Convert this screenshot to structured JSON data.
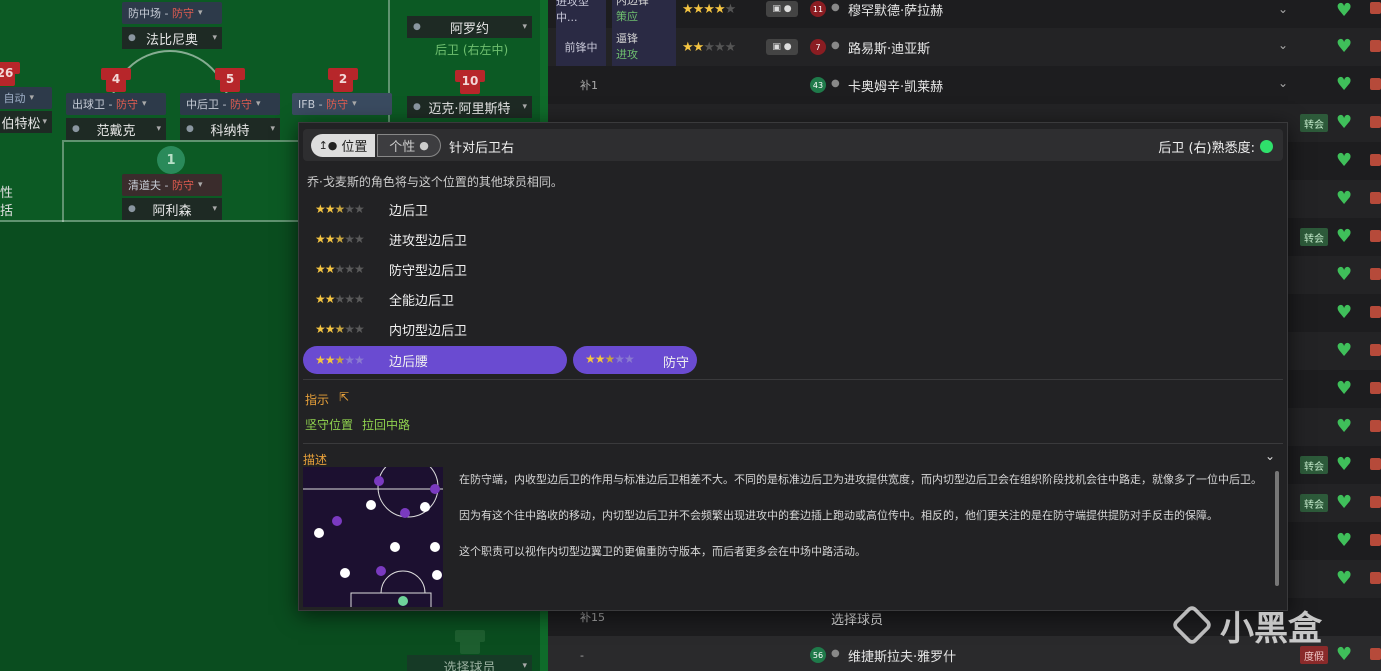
{
  "pitch": {
    "positions": [
      {
        "role": "防中场",
        "duty": "防守",
        "name": "法比尼奥"
      },
      {
        "role": "",
        "duty": "",
        "name": "阿罗约",
        "sub": "后卫 (右左中)"
      },
      {
        "role": "",
        "duty": "自动",
        "name": "伯特松"
      },
      {
        "role": "出球卫",
        "duty": "防守",
        "name": "范戴克",
        "number": "4"
      },
      {
        "role": "中后卫",
        "duty": "防守",
        "name": "科纳特",
        "number": "5"
      },
      {
        "role": "IFB",
        "duty": "防守",
        "name": "",
        "number": "2"
      },
      {
        "role": "",
        "duty": "",
        "name": "迈克·阿里斯特",
        "number": "10"
      },
      {
        "role": "清道夫",
        "duty": "防守",
        "name": "阿利森",
        "number": "1"
      }
    ],
    "side_text_1": "性",
    "side_text_2": "括",
    "left_number": "26",
    "bottom_select": "选择球员"
  },
  "squad": {
    "rows": [
      {
        "pos": "进攻型中...",
        "role": "内边锋",
        "duty": "策应",
        "stars_full": 4,
        "stars_half": 0,
        "num": "11",
        "name": "穆罕默德·萨拉赫"
      },
      {
        "pos": "前锋中",
        "role": "逼锋",
        "duty": "进攻",
        "stars_full": 2,
        "stars_half": 0,
        "num": "7",
        "name": "路易斯·迪亚斯"
      },
      {
        "pos": "补1",
        "role": "",
        "duty": "",
        "num": "43",
        "name": "卡奥姆辛·凯莱赫"
      }
    ],
    "transfer_label": "转会",
    "loan_label": "度假",
    "sub15": "补15",
    "dash": "-",
    "select_player": "选择球员",
    "bottom_name": "维捷斯拉夫·雅罗什",
    "bottom_num": "56"
  },
  "popup": {
    "tab_position": "位置",
    "tab_personality": "个性",
    "title": "针对后卫右",
    "familiarity_label": "后卫 (右)熟悉度:",
    "subtitle": "乔·戈麦斯的角色将与这个位置的其他球员相同。",
    "roles": [
      {
        "name": "边后卫",
        "full": 2,
        "half": 1
      },
      {
        "name": "进攻型边后卫",
        "full": 2,
        "half": 1
      },
      {
        "name": "防守型边后卫",
        "full": 2,
        "half": 0
      },
      {
        "name": "全能边后卫",
        "full": 2,
        "half": 0
      },
      {
        "name": "内切型边后卫",
        "full": 2,
        "half": 1
      },
      {
        "name": "边后腰",
        "full": 2,
        "half": 1,
        "selected": true
      }
    ],
    "duty": {
      "name": "防守",
      "full": 2,
      "half": 1
    },
    "instructions_label": "指示",
    "instructions": [
      "坚守位置",
      "拉回中路"
    ],
    "description_label": "描述",
    "description": [
      "在防守端，内收型边后卫的作用与标准边后卫相差不大。不同的是标准边后卫为进攻提供宽度，而内切型边后卫会在组织阶段找机会往中路走，就像多了一位中后卫。",
      "因为有这个往中路收的移动，内切型边后卫并不会频繁出现进攻中的套边插上跑动或高位传中。相反的，他们更关注的是在防守端提供提防对手反击的保障。",
      "这个职责可以视作内切型边翼卫的更偏重防守版本，而后者更多会在中场中路活动。"
    ]
  },
  "watermark": "小黑盒",
  "colors": {
    "accent": "#6a4bd1",
    "star": "#f5c542",
    "heart": "#3fbf5a",
    "famil": "#2fe06b",
    "orange": "#e8a13a"
  }
}
